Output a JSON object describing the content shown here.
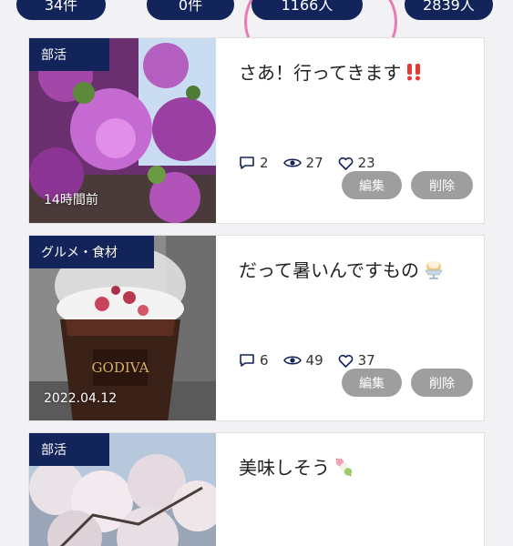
{
  "stats": {
    "pill_1": "34件",
    "pill_2": "0件",
    "pill_3": "1166人",
    "pill_4": "2839人"
  },
  "colors": {
    "navy": "#13245a",
    "highlight_ring": "#e87ab4",
    "button_gray": "#9e9e9e"
  },
  "posts": [
    {
      "category": "部活",
      "timestamp": "14時間前",
      "title": "さあ！行ってきます",
      "title_emoji": "double-exclamation-icon",
      "comments": "2",
      "views": "27",
      "likes": "23",
      "edit_label": "編集",
      "delete_label": "削除"
    },
    {
      "category": "グルメ・食材",
      "timestamp": "2022.04.12",
      "title": "だって暑いんですもの",
      "title_emoji": "sundae-icon",
      "image_text": "GODIVA",
      "comments": "6",
      "views": "49",
      "likes": "37",
      "edit_label": "編集",
      "delete_label": "削除"
    },
    {
      "category": "部活",
      "title": "美味しそう",
      "title_emoji": "dango-icon"
    }
  ]
}
